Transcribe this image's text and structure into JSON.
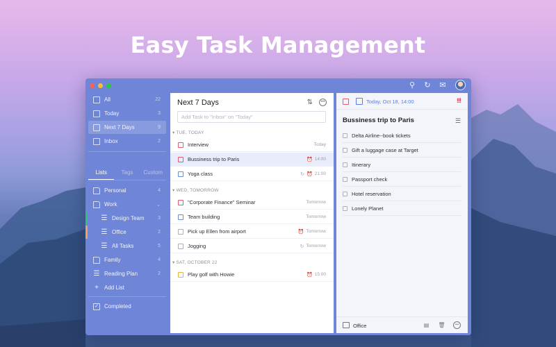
{
  "headline": "Easy Task Management",
  "sidebar": {
    "smart_lists": [
      {
        "label": "All",
        "count": "22"
      },
      {
        "label": "Today",
        "count": "3"
      },
      {
        "label": "Next 7 Days",
        "count": "9"
      },
      {
        "label": "Inbox",
        "count": "2"
      }
    ],
    "tabs": [
      "Lists",
      "Tags",
      "Custom"
    ],
    "lists": [
      {
        "label": "Personal",
        "count": "4"
      },
      {
        "label": "Work"
      },
      {
        "label": "Design Team",
        "count": "3"
      },
      {
        "label": "Office",
        "count": "2"
      },
      {
        "label": "All Tasks",
        "count": "5"
      },
      {
        "label": "Family",
        "count": "4"
      },
      {
        "label": "Reading Plan",
        "count": "2"
      }
    ],
    "add_list": "Add List",
    "completed": "Completed"
  },
  "middle": {
    "title": "Next 7 Days",
    "add_placeholder": "Add Task to \"Inbox\" on \"Today\"",
    "sections": [
      {
        "label": "TUE, TODAY"
      },
      {
        "label": "WED, TOMORROW"
      },
      {
        "label": "SAT, OCTOBER 22"
      }
    ],
    "tasks": [
      {
        "title": "Interview",
        "meta": "Today"
      },
      {
        "title": "Bussiness trip to Paris",
        "meta": "14:00"
      },
      {
        "title": "Yoga class",
        "meta": "21:00"
      },
      {
        "title": "\"Corporate Finance\" Seminar",
        "meta": "Tomorrow"
      },
      {
        "title": "Team building",
        "meta": "Tomorrow"
      },
      {
        "title": "Pick up Ellen from airport",
        "meta": "Tomorrow"
      },
      {
        "title": "Jogging",
        "meta": "Tomorrow"
      },
      {
        "title": "Play golf with Howie",
        "meta": "15:00"
      }
    ]
  },
  "detail": {
    "date": "Today, Oct 18, 14:00",
    "priority": "!!!",
    "title": "Bussiness trip to Paris",
    "subtasks": [
      "Delta Airline--book tickets",
      "Gift a luggage case at Target",
      "Itinerary",
      "Passport check",
      "Hotel reservation",
      "Lonely Planet"
    ],
    "project": "Office"
  },
  "colors": {
    "accent": "#5b7ee0",
    "sidebar": "#6f86d8",
    "priority": "#e0415a"
  }
}
